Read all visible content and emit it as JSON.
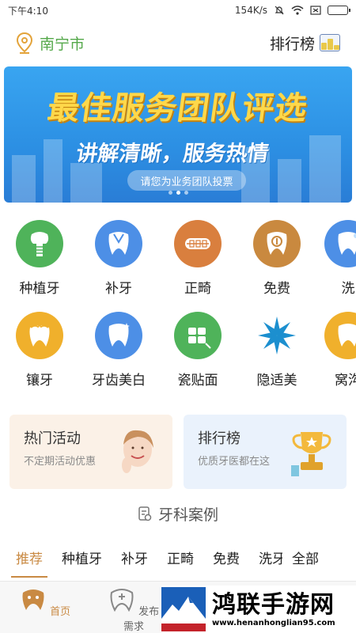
{
  "status_bar": {
    "time": "下午4:10",
    "network_speed": "154K/s"
  },
  "header": {
    "city": "南宁市",
    "ranking_label": "排行榜",
    "location_icon": "location-pin-icon",
    "ranking_icon": "podium-icon"
  },
  "banner": {
    "title": "最佳服务团队评选",
    "subtitle": "讲解清晰，服务热情",
    "vote_text": "请您为业务团队投票"
  },
  "categories_row1": [
    {
      "label": "种植牙",
      "icon": "implant-tooth-icon"
    },
    {
      "label": "补牙",
      "icon": "tooth-filling-icon"
    },
    {
      "label": "正畸",
      "icon": "braces-icon"
    },
    {
      "label": "免费",
      "icon": "free-icon"
    },
    {
      "label": "洗",
      "icon": "tooth-cleaning-icon"
    }
  ],
  "categories_row2": [
    {
      "label": "镶牙",
      "icon": "crown-tooth-icon"
    },
    {
      "label": "牙齿美白",
      "icon": "whitening-icon"
    },
    {
      "label": "瓷贴面",
      "icon": "veneer-icon"
    },
    {
      "label": "隐适美",
      "icon": "invisalign-icon"
    },
    {
      "label": "窝沟",
      "icon": "fissure-sealant-icon"
    }
  ],
  "cards": {
    "hot": {
      "title": "热门活动",
      "subtitle": "不定期活动优惠"
    },
    "rank": {
      "title": "排行榜",
      "subtitle": "优质牙医都在这"
    }
  },
  "cases": {
    "title": "牙科案例",
    "tabs": [
      "推荐",
      "种植牙",
      "补牙",
      "正畸",
      "免费",
      "洗牙",
      "全部"
    ]
  },
  "bottom_nav": {
    "home": "首页",
    "post": "发布需求"
  },
  "watermark": {
    "title": "鸿联手游网",
    "url": "www.henanhonglian95.com"
  },
  "colors": {
    "accent": "#c98a43",
    "city_green": "#54a84a",
    "banner_blue": "#2c8fe3"
  }
}
